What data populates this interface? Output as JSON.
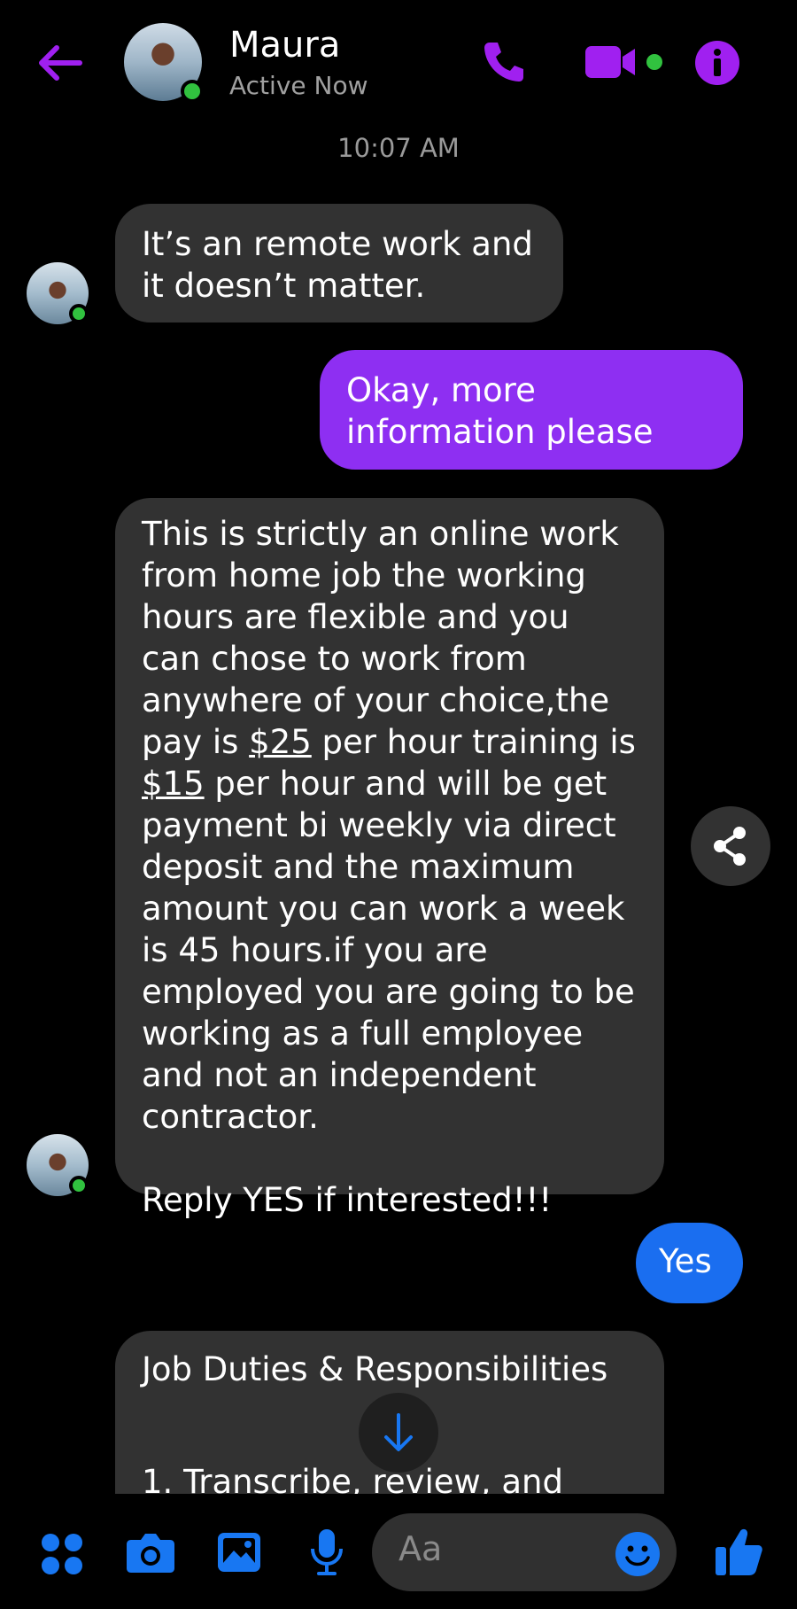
{
  "header": {
    "contact_name": "Maura",
    "status": "Active Now",
    "accent": "#a020f0",
    "icons": [
      "back-arrow-icon",
      "phone-icon",
      "video-camera-icon",
      "info-icon"
    ]
  },
  "timestamp": "10:07 AM",
  "messages": [
    {
      "from": "them",
      "text": "It’s an remote work and it doesn’t matter."
    },
    {
      "from": "me",
      "text": "Okay, more information please"
    },
    {
      "from": "them",
      "p1a": "This is strictly an online work from home job the working hours are flexible and you can chose to work from anywhere of your choice,the pay is ",
      "amt1": "$25",
      "p1b": " per hour training is ",
      "amt2": "$15",
      "p1c": " per hour and will be get payment bi weekly via direct deposit and the maximum amount you can work a week is 45 hours.if you are employed you are going to be working as a full employee and not an independent contractor.",
      "p2": "Reply YES if interested!!!"
    },
    {
      "from": "me",
      "text": "Yes"
    },
    {
      "from": "them",
      "title": "Job Duties & Responsibilities",
      "partial": "1. Transcribe, review, and"
    }
  ],
  "composer": {
    "placeholder": "Aa"
  },
  "colors": {
    "my_bubble": "#8e2ff2",
    "my_bubble_2": "#1a6ef0",
    "their_bubble": "#323232",
    "toolbar": "#1877f2"
  }
}
